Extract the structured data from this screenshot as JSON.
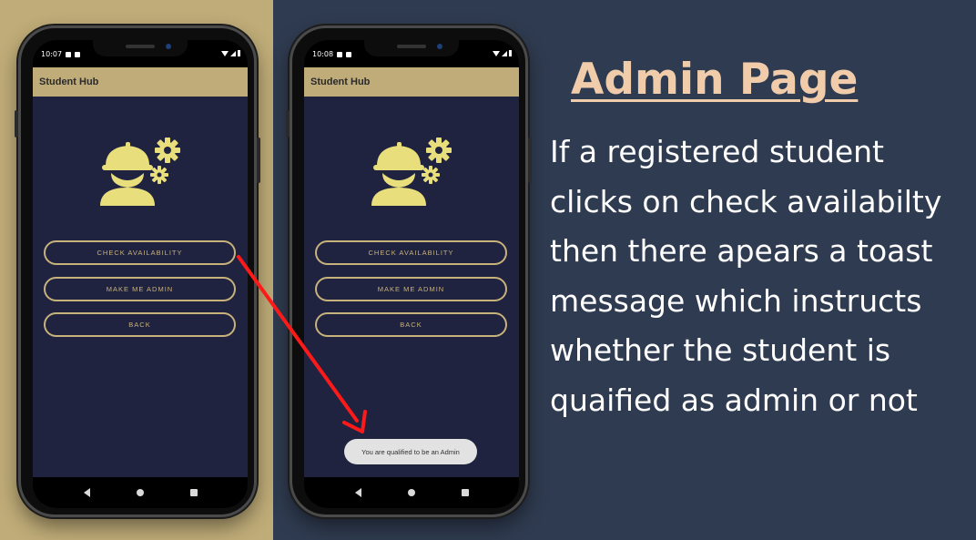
{
  "phones": [
    {
      "status_time": "10:07",
      "app_title": "Student Hub",
      "buttons": [
        "CHECK AVAILABILITY",
        "MAKE ME ADMIN",
        "BACK"
      ],
      "toast": ""
    },
    {
      "status_time": "10:08",
      "app_title": "Student Hub",
      "buttons": [
        "CHECK AVAILABILITY",
        "MAKE ME ADMIN",
        "BACK"
      ],
      "toast": "You are qualified to be an Admin"
    }
  ],
  "hero_icon": "worker-with-gears-icon",
  "nav_icons": [
    "back-icon",
    "home-icon",
    "recents-icon"
  ],
  "colors": {
    "left_background": "#bfac78",
    "right_background": "#2f3b50",
    "app_bar": "#bfac78",
    "screen_background": "#1f2340",
    "button_border": "#c8b27c",
    "icon_color": "#e8df7c",
    "arrow": "#ff1a1a",
    "title": "#f0ccaa"
  },
  "slide": {
    "title": "Admin Page",
    "description_lines": [
      "If a registered student",
      "clicks on check availabilty",
      "then there apears a toast",
      "message which instructs",
      "whether the student is",
      "quaified as admin or not"
    ]
  }
}
